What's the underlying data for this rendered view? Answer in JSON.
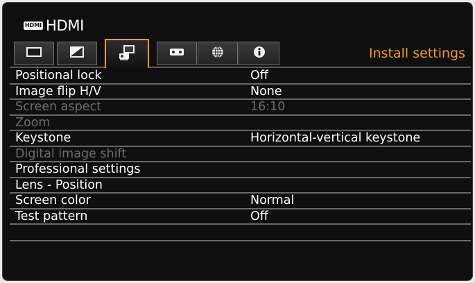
{
  "header": {
    "source_badge": "HDMI",
    "source_name": "HDMI"
  },
  "tabs": [
    {
      "name": "image-adjustment",
      "icon": "picture-icon"
    },
    {
      "name": "image-settings",
      "icon": "image-settings-icon"
    },
    {
      "name": "install-settings",
      "icon": "projector-install-icon",
      "active": true
    },
    {
      "name": "system-settings",
      "icon": "system-settings-icon"
    },
    {
      "name": "network-settings",
      "icon": "globe-icon"
    },
    {
      "name": "information",
      "icon": "info-icon"
    }
  ],
  "section_title": "Install settings",
  "menu": [
    {
      "label": "Positional lock",
      "value": "Off",
      "enabled": true
    },
    {
      "label": "Image flip H/V",
      "value": "None",
      "enabled": true
    },
    {
      "label": "Screen aspect",
      "value": "16:10",
      "enabled": false
    },
    {
      "label": "Zoom",
      "value": "",
      "enabled": false
    },
    {
      "label": "Keystone",
      "value": "Horizontal-vertical keystone",
      "enabled": true
    },
    {
      "label": "Digital image shift",
      "value": "",
      "enabled": false
    },
    {
      "label": "Professional settings",
      "value": "",
      "enabled": true
    },
    {
      "label": "Lens - Position",
      "value": "",
      "enabled": true
    },
    {
      "label": "Screen color",
      "value": "Normal",
      "enabled": true
    },
    {
      "label": "Test pattern",
      "value": "Off",
      "enabled": true
    }
  ],
  "colors": {
    "accent": "#f0a020",
    "text": "#ffffff",
    "disabled_text": "#6c6c6c",
    "background": "#0f0f0f"
  }
}
